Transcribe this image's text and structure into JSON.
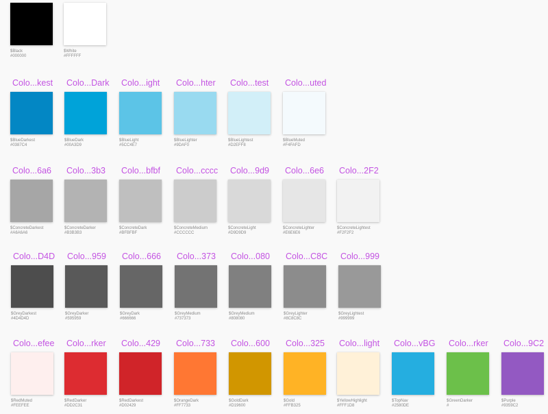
{
  "rows": [
    {
      "items": [
        {
          "label": "",
          "name": "$Black",
          "hex": "#000000",
          "color": "#000000"
        },
        {
          "label": "",
          "name": "$White",
          "hex": "#FFFFFF",
          "color": "#FFFFFF"
        }
      ]
    },
    {
      "items": [
        {
          "label": "Colo...kest",
          "name": "$BlueDarkest",
          "hex": "#0387C4",
          "color": "#0387C4"
        },
        {
          "label": "Colo...Dark",
          "name": "$BlueDark",
          "hex": "#00A3D9",
          "color": "#00A3D9"
        },
        {
          "label": "Colo...ight",
          "name": "$BlueLight",
          "hex": "#5CC4E7",
          "color": "#5CC4E7"
        },
        {
          "label": "Colo...hter",
          "name": "$BlueLighter",
          "hex": "#9DAF0",
          "color": "#99DAF0"
        },
        {
          "label": "Colo...test",
          "name": "$BlueLightest",
          "hex": "#D2EFF8",
          "color": "#D2EFF8"
        },
        {
          "label": "Colo...uted",
          "name": "$BlueMuted",
          "hex": "#F4FAFD",
          "color": "#F4FAFD"
        }
      ]
    },
    {
      "items": [
        {
          "label": "Colo...6a6",
          "name": "$ConcreteDarkest",
          "hex": "#A6A6A6",
          "color": "#A6A6A6"
        },
        {
          "label": "Colo...3b3",
          "name": "$ConcreteDarker",
          "hex": "#B3B3B3",
          "color": "#B3B3B3"
        },
        {
          "label": "Colo...bfbf",
          "name": "$ConcreteDark",
          "hex": "#BFBFBF",
          "color": "#BFBFBF"
        },
        {
          "label": "Colo...cccc",
          "name": "$ConcreteMedium",
          "hex": "#CCCCCC",
          "color": "#CCCCCC"
        },
        {
          "label": "Colo...9d9",
          "name": "$ConcreteLight",
          "hex": "#D9D9D9",
          "color": "#D9D9D9"
        },
        {
          "label": "Colo...6e6",
          "name": "$ConcreteLighter",
          "hex": "#E6E6E6",
          "color": "#E6E6E6"
        },
        {
          "label": "Colo...2F2",
          "name": "$ConcreteLightest",
          "hex": "#F2F2F2",
          "color": "#F2F2F2"
        }
      ]
    },
    {
      "items": [
        {
          "label": "Colo...D4D",
          "name": "$GreyDarkest",
          "hex": "#4D4D4D",
          "color": "#4D4D4D"
        },
        {
          "label": "Colo...959",
          "name": "$GreyDarker",
          "hex": "#595959",
          "color": "#595959"
        },
        {
          "label": "Colo...666",
          "name": "$GreyDark",
          "hex": "#666666",
          "color": "#666666"
        },
        {
          "label": "Colo...373",
          "name": "$GreyMedium",
          "hex": "#737373",
          "color": "#737373"
        },
        {
          "label": "Colo...080",
          "name": "$GreyMedium",
          "hex": "#808080",
          "color": "#808080"
        },
        {
          "label": "Colo...C8C",
          "name": "$GreyLighter",
          "hex": "#8C8C8C",
          "color": "#8C8C8C"
        },
        {
          "label": "Colo...999",
          "name": "$GreyLightest",
          "hex": "#999999",
          "color": "#999999"
        }
      ]
    },
    {
      "items": [
        {
          "label": "Colo...efee",
          "name": "$RedMuted",
          "hex": "#FEEFEE",
          "color": "#FEEFEE"
        },
        {
          "label": "Colo...rker",
          "name": "$RedDarker",
          "hex": "#DD2C31",
          "color": "#DD2C31"
        },
        {
          "label": "Colo...429",
          "name": "$RedDarkest",
          "hex": "#D02429",
          "color": "#D02429"
        },
        {
          "label": "Colo...733",
          "name": "$OrangeDark",
          "hex": "#FF7733",
          "color": "#FF7733"
        },
        {
          "label": "Colo...600",
          "name": "$GoldDark",
          "hex": "#D19600",
          "color": "#D19600"
        },
        {
          "label": "Colo...325",
          "name": "$Gold",
          "hex": "#FFB325",
          "color": "#FFB325"
        },
        {
          "label": "Colo...light",
          "name": "$YellowHighlight",
          "hex": "#FFF1D8",
          "color": "#FFF1D8"
        },
        {
          "label": "Colo...vBG",
          "name": "$TopNav",
          "hex": "#2580DE",
          "color": "#25AEE0"
        },
        {
          "label": "Colo...rker",
          "name": "$GreenDarker",
          "hex": "#",
          "color": "#6CC04A"
        },
        {
          "label": "Colo...9C2",
          "name": "$Purple",
          "hex": "#9359C2",
          "color": "#9359C2"
        }
      ]
    }
  ]
}
